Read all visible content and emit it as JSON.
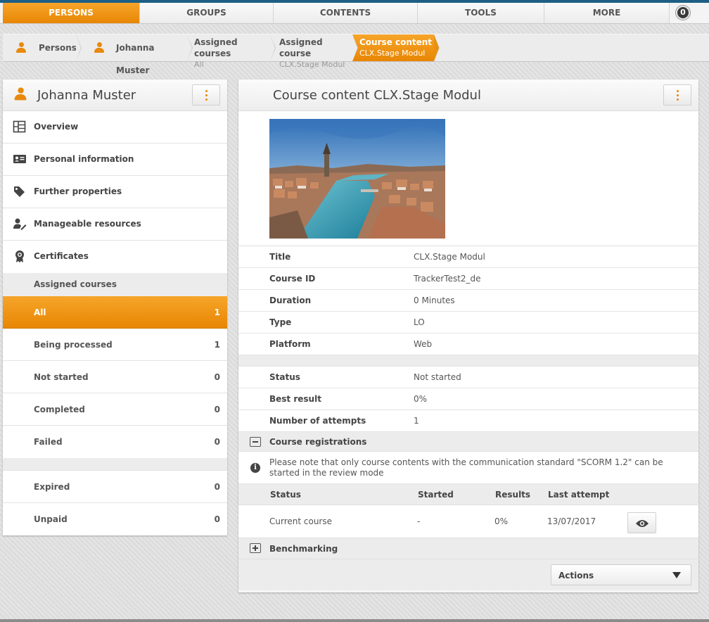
{
  "top_nav": {
    "tabs": [
      {
        "label": "PERSONS",
        "active": true
      },
      {
        "label": "GROUPS",
        "active": false
      },
      {
        "label": "CONTENTS",
        "active": false
      },
      {
        "label": "TOOLS",
        "active": false
      },
      {
        "label": "MORE",
        "active": false
      }
    ],
    "notification_count": "0"
  },
  "breadcrumb": [
    {
      "title": "Persons",
      "sub": "",
      "icon": "person-icon"
    },
    {
      "title": "Johanna Muster",
      "sub": "",
      "icon": "person-icon"
    },
    {
      "title": "Assigned courses",
      "sub": "All"
    },
    {
      "title": "Assigned course",
      "sub": "CLX.Stage Modul"
    },
    {
      "title": "Course content",
      "sub": "CLX.Stage Modul",
      "active": true
    }
  ],
  "left_panel": {
    "person_name": "Johanna Muster",
    "menu": [
      {
        "label": "Overview",
        "icon": "overview-icon"
      },
      {
        "label": "Personal information",
        "icon": "id-card-icon"
      },
      {
        "label": "Further properties",
        "icon": "tag-icon"
      },
      {
        "label": "Manageable resources",
        "icon": "user-edit-icon"
      },
      {
        "label": "Certificates",
        "icon": "certificate-icon"
      }
    ],
    "assigned_courses_label": "Assigned courses",
    "filters": [
      {
        "label": "All",
        "count": "1",
        "active": true
      },
      {
        "label": "Being processed",
        "count": "1"
      },
      {
        "label": "Not started",
        "count": "0"
      },
      {
        "label": "Completed",
        "count": "0"
      },
      {
        "label": "Failed",
        "count": "0"
      }
    ],
    "extra_filters": [
      {
        "label": "Expired",
        "count": "0"
      },
      {
        "label": "Unpaid",
        "count": "0"
      }
    ]
  },
  "content": {
    "title": "Course content CLX.Stage Modul",
    "details": [
      {
        "key": "Title",
        "value": "CLX.Stage Modul"
      },
      {
        "key": "Course ID",
        "value": "TrackerTest2_de"
      },
      {
        "key": "Duration",
        "value": "0 Minutes"
      },
      {
        "key": "Type",
        "value": "LO"
      },
      {
        "key": "Platform",
        "value": "Web"
      }
    ],
    "status_details": [
      {
        "key": "Status",
        "value": "Not started"
      },
      {
        "key": "Best result",
        "value": "0%"
      },
      {
        "key": "Number of attempts",
        "value": "1"
      }
    ],
    "registrations": {
      "label": "Course registrations",
      "note": "Please note that only course contents with the communication standard \"SCORM 1.2\" can be started in the review mode",
      "columns": [
        "Status",
        "Started",
        "Results",
        "Last attempt"
      ],
      "rows": [
        {
          "status": "Current course",
          "started": "-",
          "results": "0%",
          "last_attempt": "13/07/2017"
        }
      ]
    },
    "benchmarking_label": "Benchmarking",
    "actions_label": "Actions"
  }
}
